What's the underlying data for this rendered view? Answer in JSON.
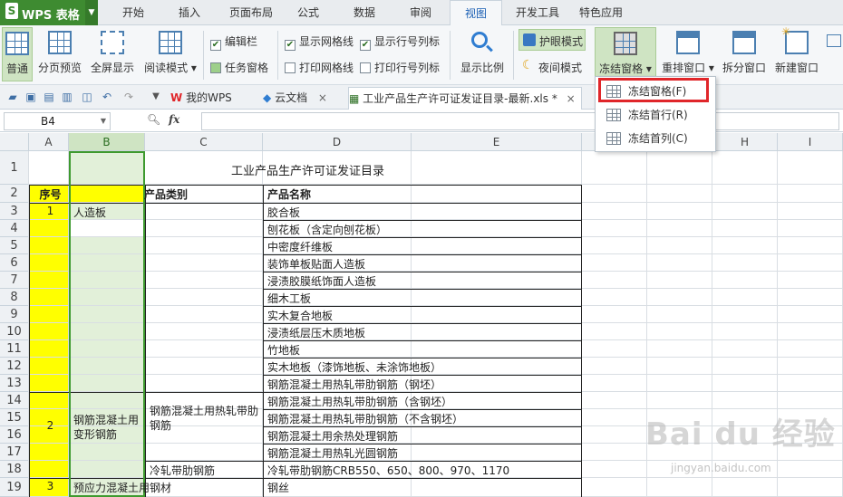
{
  "app": {
    "logo_label": "WPS 表格",
    "logo_letter": "S"
  },
  "menu": [
    "开始",
    "插入",
    "页面布局",
    "公式",
    "数据",
    "审阅",
    "视图",
    "开发工具",
    "特色应用"
  ],
  "menu_active": "视图",
  "ribbon": {
    "normal": "普通",
    "page_preview": "分页预览",
    "fullscreen": "全屏显示",
    "reading": "阅读模式",
    "edit_bar": "编辑栏",
    "task_pane": "任务窗格",
    "show_grid": "显示网格线",
    "show_headers": "显示行号列标",
    "print_grid": "打印网格线",
    "print_headers": "打印行号列标",
    "zoom": "显示比例",
    "eye_mode": "护眼模式",
    "night_mode": "夜间模式",
    "freeze": "冻结窗格",
    "rearrange": "重排窗口",
    "split": "拆分窗口",
    "new_window": "新建窗口"
  },
  "tabs": {
    "my_wps": "我的WPS",
    "cloud": "云文档",
    "doc": "工业产品生产许可证发证目录-最新.xls *"
  },
  "formula": {
    "cell_ref": "B4",
    "fx": "fx",
    "value": ""
  },
  "columns": [
    "A",
    "B",
    "C",
    "D",
    "E",
    "F",
    "G",
    "H",
    "I"
  ],
  "rows": [
    "1",
    "2",
    "3",
    "4",
    "5",
    "6",
    "7",
    "8",
    "9",
    "10",
    "11",
    "12",
    "13",
    "14",
    "15",
    "16",
    "17",
    "18",
    "19"
  ],
  "sheet": {
    "title": "工业产品生产许可证发证目录",
    "headers": {
      "seq": "序号",
      "category": "产品类别",
      "name": "产品名称"
    },
    "seq": [
      "1",
      "2",
      "3"
    ],
    "categories": [
      "人造板",
      "钢筋混凝土用变形钢筋",
      "预应力混凝土用钢材"
    ],
    "subcategories": [
      "钢筋混凝土用热轧带肋钢筋",
      "冷轧带肋钢筋"
    ],
    "products": [
      "胶合板",
      "刨花板（含定向刨花板）",
      "中密度纤维板",
      "装饰单板贴面人造板",
      "浸渍胶膜纸饰面人造板",
      "细木工板",
      "实木复合地板",
      "浸渍纸层压木质地板",
      "竹地板",
      "实木地板（漆饰地板、未涂饰地板）",
      "钢筋混凝土用热轧带肋钢筋（钢坯）",
      "钢筋混凝土用热轧带肋钢筋（含钢坯）",
      "钢筋混凝土用热轧带肋钢筋（不含钢坯）",
      "钢筋混凝土用余热处理钢筋",
      "钢筋混凝土用热轧光圆钢筋",
      "冷轧带肋钢筋CRB550、650、800、970、1170",
      "钢丝"
    ]
  },
  "freeze_menu": [
    "冻结窗格(F)",
    "冻结首行(R)",
    "冻结首列(C)"
  ],
  "watermark": {
    "text": "Bai du 经验",
    "url": "jingyan.baidu.com"
  },
  "colors": {
    "brand_green": "#3e8b31",
    "header_yellow": "#ffff00",
    "selection_green": "#e2f0d9",
    "highlight_red": "#e0262a"
  }
}
